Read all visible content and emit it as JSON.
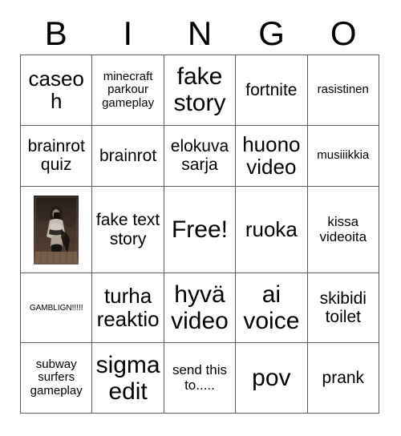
{
  "board": {
    "title_letters": [
      "B",
      "I",
      "N",
      "G",
      "O"
    ],
    "free_label": "Free!",
    "rows": [
      [
        {
          "text": "caseoh",
          "size": "lg"
        },
        {
          "text": "minecraft parkour gameplay",
          "size": "xs"
        },
        {
          "text": "fake story",
          "size": "xl"
        },
        {
          "text": "fortnite",
          "size": "md"
        },
        {
          "text": "rasistinen",
          "size": "xs"
        }
      ],
      [
        {
          "text": "brainrot quiz",
          "size": "md"
        },
        {
          "text": "brainrot",
          "size": "md"
        },
        {
          "text": "elokuva sarja",
          "size": "md"
        },
        {
          "text": "huono video",
          "size": "lg"
        },
        {
          "text": "musiiikkia",
          "size": "xs"
        }
      ],
      [
        {
          "text": "",
          "size": "md",
          "kind": "photo",
          "photo_alt": "mirror-selfie-photo"
        },
        {
          "text": "fake text story",
          "size": "md"
        },
        {
          "text": "Free!",
          "size": "xl",
          "kind": "free"
        },
        {
          "text": "ruoka",
          "size": "lg"
        },
        {
          "text": "kissa videoita",
          "size": "sm"
        }
      ],
      [
        {
          "text": "GAMBLIGN!!!!!",
          "size": "xxs"
        },
        {
          "text": "turha reaktio",
          "size": "lg"
        },
        {
          "text": "hyvä video",
          "size": "xl"
        },
        {
          "text": "ai voice",
          "size": "xl"
        },
        {
          "text": "skibidi toilet",
          "size": "md"
        }
      ],
      [
        {
          "text": "subway surfers gameplay",
          "size": "xs"
        },
        {
          "text": "sigma edit",
          "size": "xl"
        },
        {
          "text": "send this to.....",
          "size": "sm"
        },
        {
          "text": "pov",
          "size": "xl"
        },
        {
          "text": "prank",
          "size": "md"
        }
      ]
    ]
  }
}
